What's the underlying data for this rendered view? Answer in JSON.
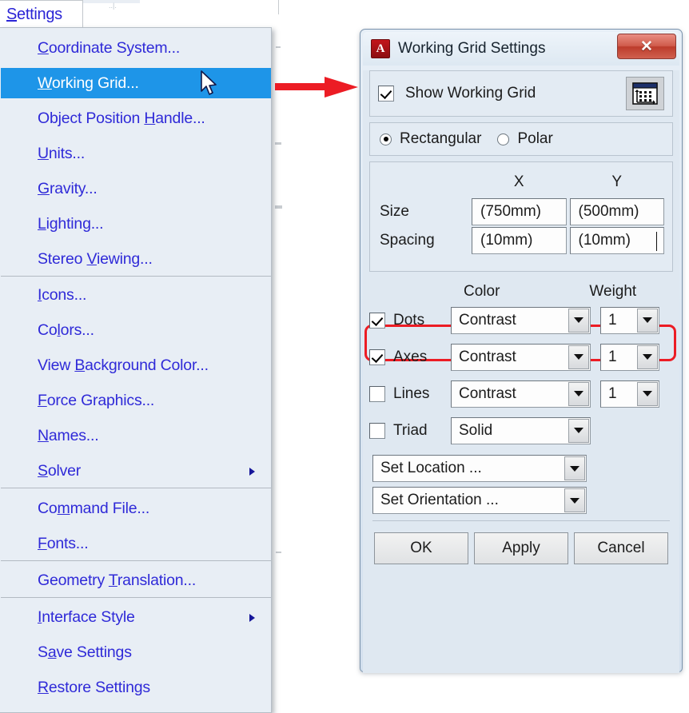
{
  "menu": {
    "title": "Settings",
    "title_accel": "S",
    "items": [
      {
        "label": "Coordinate System...",
        "accel": "C",
        "selected": false,
        "submenu": false
      },
      {
        "label": "Working Grid...",
        "accel": "W",
        "selected": true,
        "submenu": false
      },
      {
        "label": "Object Position Handle...",
        "accel": "H",
        "selected": false,
        "submenu": false
      },
      {
        "label": "Units...",
        "accel": "U",
        "selected": false,
        "submenu": false
      },
      {
        "label": "Gravity...",
        "accel": "G",
        "selected": false,
        "submenu": false
      },
      {
        "label": "Lighting...",
        "accel": "L",
        "selected": false,
        "submenu": false
      },
      {
        "label": "Stereo Viewing...",
        "accel": "V",
        "selected": false,
        "submenu": false
      },
      {
        "label": "Icons...",
        "accel": "I",
        "selected": false,
        "submenu": false
      },
      {
        "label": "Colors...",
        "accel": "l",
        "selected": false,
        "submenu": false
      },
      {
        "label": "View Background Color...",
        "accel": "B",
        "selected": false,
        "submenu": false
      },
      {
        "label": "Force Graphics...",
        "accel": "F",
        "selected": false,
        "submenu": false
      },
      {
        "label": "Names...",
        "accel": "N",
        "selected": false,
        "submenu": false
      },
      {
        "label": "Solver",
        "accel": "S",
        "selected": false,
        "submenu": true
      },
      {
        "label": "Command File...",
        "accel": "m",
        "selected": false,
        "submenu": false
      },
      {
        "label": "Fonts...",
        "accel": "F",
        "selected": false,
        "submenu": false
      },
      {
        "label": "Geometry Translation...",
        "accel": "T",
        "selected": false,
        "submenu": false
      },
      {
        "label": "Interface Style",
        "accel": "I",
        "selected": false,
        "submenu": true
      },
      {
        "label": "Save Settings",
        "accel": "a",
        "selected": false,
        "submenu": false
      },
      {
        "label": "Restore Settings",
        "accel": "R",
        "selected": false,
        "submenu": false
      }
    ],
    "highlight_color": "#1e95e8",
    "text_color": "#2f2ad8"
  },
  "annotation": {
    "arrow_color": "#ec1c24",
    "highlight_box_color": "#ec1c24"
  },
  "dialog": {
    "title": "Working Grid Settings",
    "app_icon_letter": "A",
    "close_label": "✕",
    "show_grid": {
      "label": "Show Working Grid",
      "checked": true
    },
    "grid_icon_name": "working-grid-icon",
    "shape": {
      "options": [
        {
          "label": "Rectangular",
          "selected": true
        },
        {
          "label": "Polar",
          "selected": false
        }
      ]
    },
    "dims": {
      "col_headers": [
        "X",
        "Y"
      ],
      "rows": [
        {
          "label": "Size",
          "x": "(750mm)",
          "y": "(500mm)",
          "focused": false
        },
        {
          "label": "Spacing",
          "x": "(10mm)",
          "y": "(10mm)",
          "focused": true
        }
      ]
    },
    "cw": {
      "color_header": "Color",
      "weight_header": "Weight",
      "rows": [
        {
          "name": "Dots",
          "checked": true,
          "color": "Contrast",
          "weight": "1",
          "has_weight": true
        },
        {
          "name": "Axes",
          "checked": true,
          "color": "Contrast",
          "weight": "1",
          "has_weight": true
        },
        {
          "name": "Lines",
          "checked": false,
          "color": "Contrast",
          "weight": "1",
          "has_weight": true
        },
        {
          "name": "Triad",
          "checked": false,
          "color": "Solid",
          "weight": "",
          "has_weight": false
        }
      ]
    },
    "location_combo": "Set Location ...",
    "orientation_combo": "Set Orientation ...",
    "buttons": [
      "OK",
      "Apply",
      "Cancel"
    ]
  }
}
